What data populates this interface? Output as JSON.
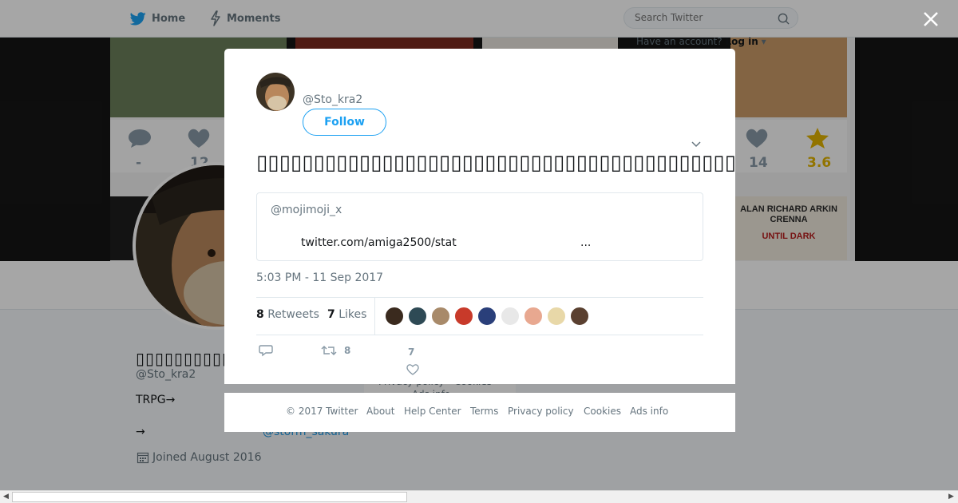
{
  "nav": {
    "home_label": "Home",
    "moments_label": "Moments",
    "search_placeholder": "Search Twitter"
  },
  "background_profile": {
    "login_prompt": "Have an account?",
    "login_link": "Log in",
    "login_caret": "▾",
    "display_name": "▯▯▯▯▯▯▯▯▯▯▯",
    "handle": "@Sto_kra2",
    "bio": "TRPG→",
    "bio_arrow": "→",
    "bio_link": "@storm_sakura",
    "joined": "Joined August 2016",
    "card_left_stat_a": "-",
    "card_left_stat_b": "12",
    "card_right_stat_a": "14",
    "card_right_stat_b": "3.6",
    "poster_title": "ALAN  RICHARD ARKIN  CRENNA",
    "poster_subtitle": "UNTIL DARK",
    "footer_privacy": "Privacy policy",
    "footer_cookies": "Cookies",
    "footer_ads": "Ads info"
  },
  "tweet": {
    "handle": "@Sto_kra2",
    "follow_label": "Follow",
    "text": "▯▯▯▯▯▯▯▯▯▯▯▯▯▯▯▯▯▯▯▯▯▯▯▯▯▯▯▯▯▯▯▯▯▯▯▯▯▯▯▯▯▯▯▯▯▯▯▯▯▯▯▯▯▯▯▯▯▯▯▯▯▯▯▯▯▯▯▯▯▯▯▯▯▯",
    "quote": {
      "user": "@mojimoji_x",
      "link_text": "twitter.com/amiga2500/stat",
      "ellipsis": "..."
    },
    "timestamp": "5:03 PM - 11 Sep 2017",
    "retweets_count": "8",
    "retweets_label": "Retweets",
    "likes_count": "7",
    "likes_label": "Likes",
    "face_colors": [
      "#3a2a1e",
      "#2e4a55",
      "#a88a6a",
      "#c83a2a",
      "#2a3f7a",
      "#e8e8e8",
      "#e8a890",
      "#e8d8a8",
      "#5a4030"
    ],
    "action_retweet_count": "8",
    "action_like_count": "7"
  },
  "footer": {
    "copyright": "© 2017 Twitter",
    "about": "About",
    "help": "Help Center",
    "terms": "Terms",
    "privacy": "Privacy policy",
    "cookies": "Cookies",
    "ads": "Ads info"
  },
  "colors": {
    "accent": "#1da1f2",
    "muted_text": "#66757f",
    "overlay": "rgba(0,0,0,0.35)"
  },
  "icons": [
    "twitter-bird-icon",
    "lightning-icon",
    "search-icon",
    "close-icon",
    "chevron-down-icon",
    "reply-icon",
    "retweet-icon",
    "heart-icon",
    "calendar-icon"
  ]
}
